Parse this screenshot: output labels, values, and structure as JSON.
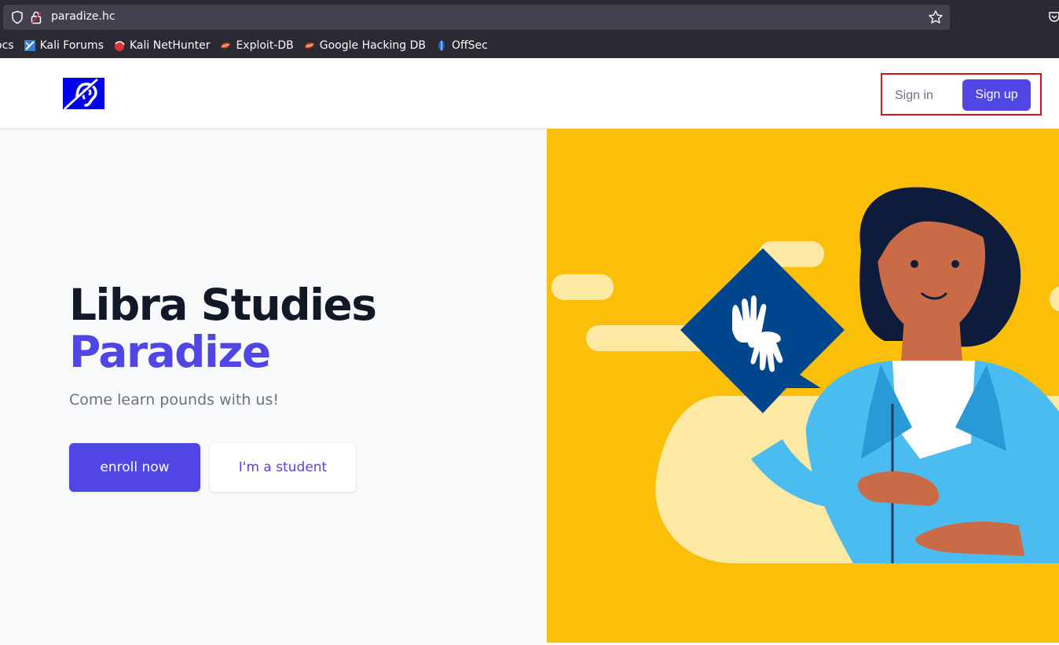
{
  "browser": {
    "url": "paradize.hc",
    "icons": [
      "shield-icon",
      "lock-icon",
      "star-icon",
      "pocket-icon"
    ],
    "bookmarks": [
      {
        "label": "ocs",
        "icon": "none"
      },
      {
        "label": "Kali Forums",
        "icon": "kali-forums-icon"
      },
      {
        "label": "Kali NetHunter",
        "icon": "kali-nethunter-icon"
      },
      {
        "label": "Exploit-DB",
        "icon": "exploit-db-icon"
      },
      {
        "label": "Google Hacking DB",
        "icon": "ghdb-icon"
      },
      {
        "label": "OffSec",
        "icon": "offsec-icon"
      }
    ]
  },
  "nav": {
    "logo": "hearing-accessibility-logo",
    "signin_label": "Sign in",
    "signup_label": "Sign up",
    "highlight_color": "#e0101a"
  },
  "hero": {
    "title_line1": "Libra Studies",
    "title_line2": "Paradize",
    "tagline": "Come learn pounds with us!",
    "enroll_label": "enroll now",
    "student_label": "I'm a student",
    "illustration": "sign-language-teacher-illustration"
  },
  "colors": {
    "accent": "#4f46e5",
    "hero_bg_right": "#fbbf0a",
    "hero_bg_left": "#f9fafb",
    "title_dark": "#111827"
  }
}
